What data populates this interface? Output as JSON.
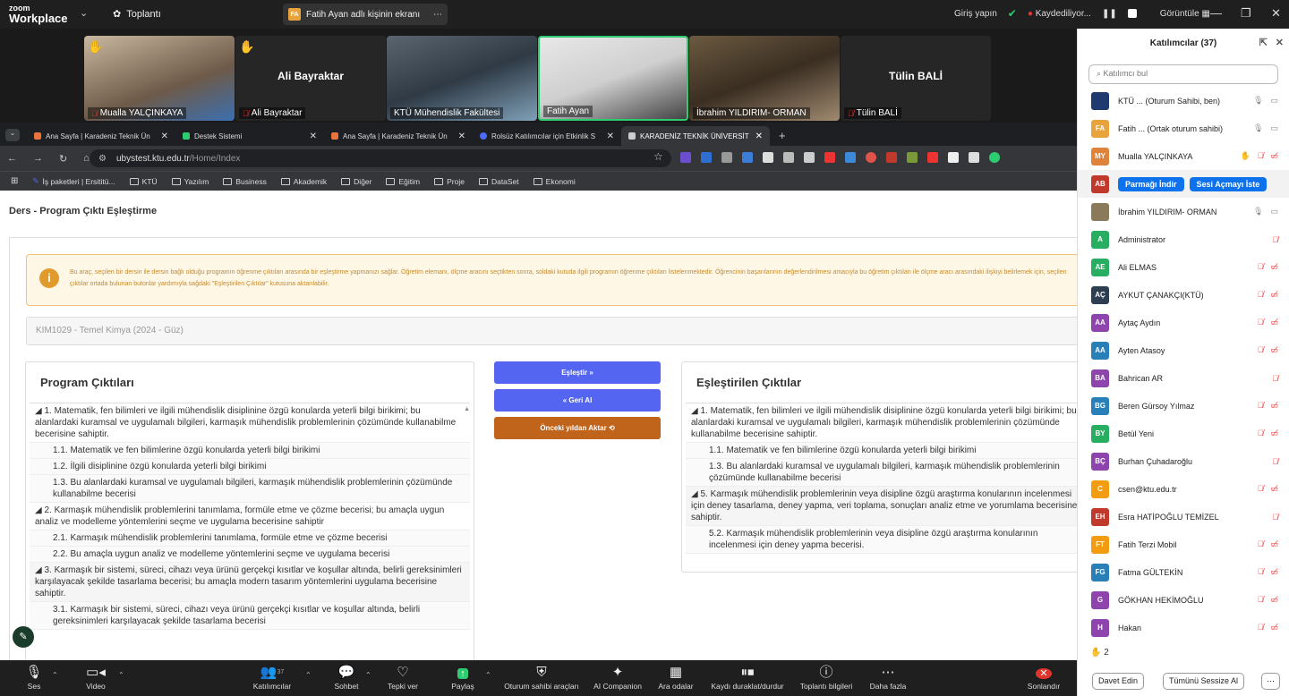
{
  "zoom": {
    "logo_line1": "zoom",
    "logo_line2": "Workplace",
    "meeting_label": "Toplantı",
    "screen_share_badge": "FA",
    "screen_share_label": "Fatih Ayan adlı kişinin ekranı",
    "signin": "Giriş yapın",
    "recording": "Kaydediliyor...",
    "view_label": "Görüntüle"
  },
  "videos": [
    {
      "name": "Mualla YALÇINKAYA"
    },
    {
      "name": "Ali Bayraktar",
      "center": "Ali Bayraktar"
    },
    {
      "name": "KTÜ Mühendislik Fakültesi"
    },
    {
      "name": "Fatih Ayan"
    },
    {
      "name": "İbrahim YILDIRIM- ORMAN"
    },
    {
      "name": "Tülin BALİ",
      "center": "Tülin BALİ"
    }
  ],
  "browser": {
    "tabs": [
      {
        "label": "Ana Sayfa | Karadeniz Teknik Ün"
      },
      {
        "label": "Destek Sistemi"
      },
      {
        "label": "Ana Sayfa | Karadeniz Teknik Ün"
      },
      {
        "label": "Rolsüz Katılımcılar için Etkinlik S"
      },
      {
        "label": "KARADENİZ TEKNİK ÜNİVERSİT"
      }
    ],
    "url_host": "ubystest.ktu.edu.tr",
    "url_path": "/Home/Index",
    "bookmarks": [
      "İş paketleri | Ersititü...",
      "KTÜ",
      "Yazılım",
      "Business",
      "Akademik",
      "Diğer",
      "Eğitim",
      "Proje",
      "DataSet",
      "Ekonomi"
    ]
  },
  "page": {
    "title": "Ders - Program Çıktı Eşleştirme",
    "info_text": "Bu araç, seçilen bir dersin ile dersin bağlı olduğu programın öğrenme çıktıları arasında bir eşleştirme yapmanızı sağlar. Öğretim elemanı, ölçme aracını seçtikten sonra, soldaki kutuda ilgili programın öğrenme çıktıları listelenmektedir. Öğrencinin başarılarının değerlendirilmesi amacıyla bu öğretim çıktıları ile ölçme aracı arasındaki ilişkiyi belirlemek için, seçilen çıktılar ortada bulunan butonlar yardımıyla sağdaki \"Eşleştirilen Çıktılar\" kutusuna aktarılabilir.",
    "course": "KIM1029 - Temel Kimya (2024 - Güz)",
    "left_title": "Program Çıktıları",
    "right_title": "Eşleştirilen Çıktılar",
    "btn_match": "Eşleştir »",
    "btn_back": "« Geri Al",
    "btn_prev": "Önceki yıldan Aktar ⟲",
    "left_items": [
      {
        "t": "◢ 1. Matematik, fen bilimleri ve ilgili mühendislik disiplinine özgü konularda yeterli bilgi birikimi; bu alanlardaki kuramsal ve uygulamalı bilgileri, karmaşık mühendislik problemlerinin çözümünde kullanabilme becerisine sahiptir.",
        "sub": false
      },
      {
        "t": "1.1. Matematik ve fen bilimlerine özgü konularda yeterli bilgi birikimi",
        "sub": true
      },
      {
        "t": "1.2. İlgili disiplinine özgü konularda yeterli bilgi birikimi",
        "sub": true
      },
      {
        "t": "1.3. Bu alanlardaki kuramsal ve uygulamalı bilgileri, karmaşık mühendislik problemlerinin çözümünde kullanabilme becerisi",
        "sub": true
      },
      {
        "t": "◢ 2. Karmaşık mühendislik problemlerini tanımlama, formüle etme ve çözme becerisi; bu amaçla uygun analiz ve modelleme yöntemlerini seçme ve uygulama becerisine sahiptir",
        "sub": false
      },
      {
        "t": "2.1. Karmaşık mühendislik problemlerini tanımlama, formüle etme ve çözme becerisi",
        "sub": true
      },
      {
        "t": "2.2. Bu amaçla uygun analiz ve modelleme yöntemlerini seçme ve uygulama becerisi",
        "sub": true
      },
      {
        "t": "◢ 3. Karmaşık bir sistemi, süreci, cihazı veya ürünü gerçekçi kısıtlar ve koşullar altında, belirli gereksinimleri karşılayacak şekilde tasarlama becerisi; bu amaçla modern tasarım yöntemlerini uygulama becerisine sahiptir.",
        "sub": false
      },
      {
        "t": "3.1. Karmaşık bir sistemi, süreci, cihazı veya ürünü gerçekçi kısıtlar ve koşullar altında, belirli gereksinimleri karşılayacak şekilde tasarlama becerisi",
        "sub": true
      }
    ],
    "right_items": [
      {
        "t": "◢ 1. Matematik, fen bilimleri ve ilgili mühendislik disiplinine özgü konularda yeterli bilgi birikimi; bu alanlardaki kuramsal ve uygulamalı bilgileri, karmaşık mühendislik problemlerinin çözümünde kullanabilme becerisine sahiptir.",
        "sub": false
      },
      {
        "t": "1.1. Matematik ve fen bilimlerine özgü konularda yeterli bilgi birikimi",
        "sub": true
      },
      {
        "t": "1.3. Bu alanlardaki kuramsal ve uygulamalı bilgileri, karmaşık mühendislik problemlerinin çözümünde kullanabilme becerisi",
        "sub": true
      },
      {
        "t": "◢ 5. Karmaşık mühendislik problemlerinin veya disipline özgü araştırma konularının incelenmesi için deney tasarlama, deney yapma, veri toplama, sonuçları analiz etme ve yorumlama becerisine sahiptir.",
        "sub": false
      },
      {
        "t": "5.2. Karmaşık mühendislik problemlerinin veya disipline özgü araştırma konularının incelenmesi için deney yapma becerisi.",
        "sub": true
      }
    ]
  },
  "participants": {
    "title": "Katılımcılar (37)",
    "search_placeholder": "Katılımcı bul",
    "list": [
      {
        "init": "",
        "name": "KTÜ ...  (Oturum Sahibi, ben)",
        "color": "#1e3a6e"
      },
      {
        "init": "FA",
        "name": "Fatih ... (Ortak oturum sahibi)",
        "color": "#e8a33d"
      },
      {
        "init": "MY",
        "name": "Mualla YALÇINKAYA",
        "color": "#e0833a"
      },
      {
        "init": "AB",
        "name": "",
        "color": "#c0392b"
      },
      {
        "init": "",
        "name": "İbrahim YILDIRIM- ORMAN",
        "color": "#8a7a5a"
      },
      {
        "init": "A",
        "name": "Administrator",
        "color": "#27ae60"
      },
      {
        "init": "AE",
        "name": "Ali ELMAS",
        "color": "#27ae60"
      },
      {
        "init": "AÇ",
        "name": "AYKUT ÇANAKÇI(KTÜ)",
        "color": "#2c3e50"
      },
      {
        "init": "AA",
        "name": "Aytaç Aydın",
        "color": "#8e44ad"
      },
      {
        "init": "AA",
        "name": "Ayten Atasoy",
        "color": "#2980b9"
      },
      {
        "init": "BA",
        "name": "Bahrican AR",
        "color": "#8e44ad"
      },
      {
        "init": "BG",
        "name": "Beren Gürsoy Yılmaz",
        "color": "#2980b9"
      },
      {
        "init": "BY",
        "name": "Betül Yeni",
        "color": "#27ae60"
      },
      {
        "init": "BÇ",
        "name": "Burhan Çuhadaroğlu",
        "color": "#8e44ad"
      },
      {
        "init": "C",
        "name": "csen@ktu.edu.tr",
        "color": "#f39c12"
      },
      {
        "init": "EH",
        "name": "Esra HATİPOĞLU TEMİZEL",
        "color": "#c0392b"
      },
      {
        "init": "FT",
        "name": "Fatih Terzi Mobil",
        "color": "#f39c12"
      },
      {
        "init": "FG",
        "name": "Fatma GÜLTEKİN",
        "color": "#2980b9"
      },
      {
        "init": "G",
        "name": "GÖKHAN HEKİMOĞLU",
        "color": "#8e44ad"
      },
      {
        "init": "H",
        "name": "Hakan",
        "color": "#8e44ad"
      }
    ],
    "btn_lower_hand": "Parmağı İndir",
    "btn_ask_unmute": "Sesi Açmayı İste",
    "raised_count": "2",
    "btn_invite": "Davet Edin",
    "btn_mute_all": "Tümünü Sessize Al"
  },
  "toolbar": {
    "audio": "Ses",
    "video": "Video",
    "participants": "Katılımcılar",
    "participants_count": "37",
    "chat": "Sohbet",
    "reactions": "Tepki ver",
    "share": "Paylaş",
    "host_tools": "Oturum sahibi araçları",
    "ai_companion": "AI Companion",
    "apps": "Ara odalar",
    "pause_rec": "Kaydı duraklat/durdur",
    "info": "Toplantı bilgileri",
    "more": "Daha fazla",
    "end": "Sonlandır"
  }
}
